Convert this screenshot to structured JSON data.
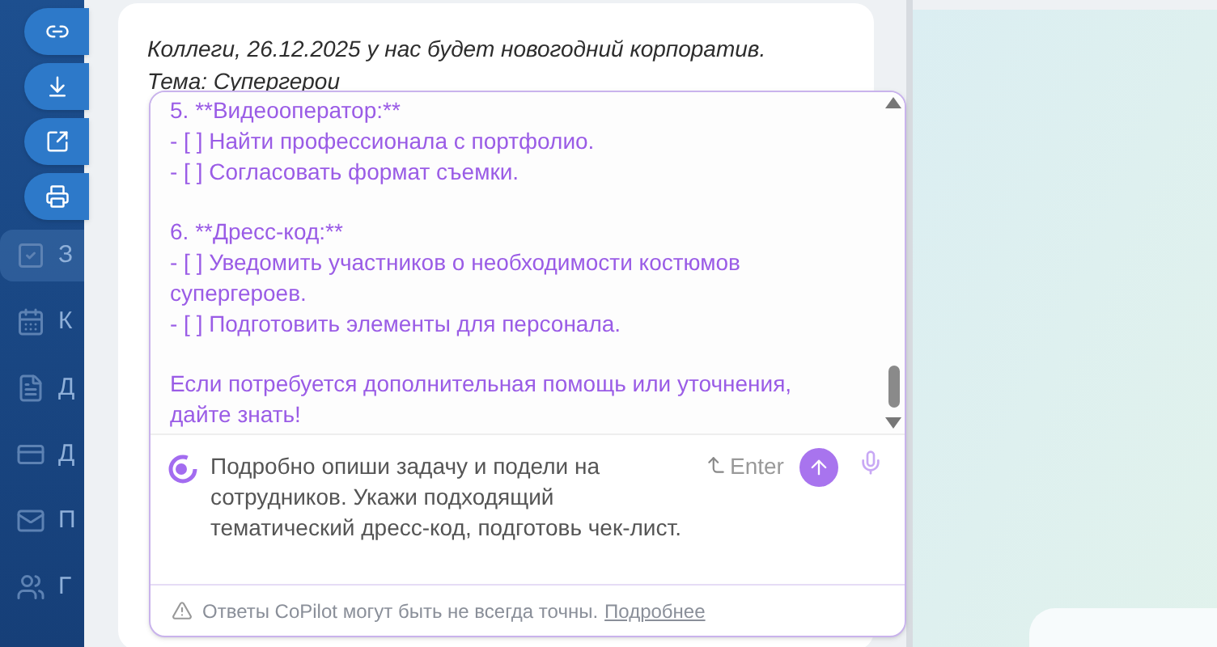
{
  "sidebar": {
    "items": [
      {
        "kind": "check",
        "label": "З",
        "selected": true
      },
      {
        "kind": "calendar",
        "label": "К",
        "selected": false
      },
      {
        "kind": "document",
        "label": "Д",
        "selected": false
      },
      {
        "kind": "card",
        "label": "Д",
        "selected": false
      },
      {
        "kind": "mail",
        "label": "П",
        "selected": false
      },
      {
        "kind": "users",
        "label": "Г",
        "selected": false
      }
    ]
  },
  "actions": [
    {
      "kind": "link"
    },
    {
      "kind": "download"
    },
    {
      "kind": "external"
    },
    {
      "kind": "print"
    }
  ],
  "message": {
    "lines": [
      "Коллеги, 26.12.2025 у нас будет новогодний корпоратив.",
      "Тема: Супергерои"
    ]
  },
  "copilot": {
    "answer": [
      [
        "5. **Видеооператор:**",
        "- [ ] Найти профессионала с портфолио.",
        "- [ ] Согласовать формат съемки."
      ],
      [
        "6. **Дресс-код:**",
        "- [ ] Уведомить участников о необходимости костюмов супергероев.",
        "- [ ] Подготовить элементы для персонала."
      ],
      [
        "Если потребуется дополнительная помощь или уточнения, дайте знать!"
      ]
    ],
    "prompt": {
      "value": "Подробно опиши задачу и подели на сотрудников. Укажи подходящий тематический дресс-код, подготовь чек-лист."
    },
    "enter_hint": "Enter",
    "disclaimer": "Ответы CoPilot могут быть не всегда точны.",
    "more_link": "Подробнее"
  }
}
